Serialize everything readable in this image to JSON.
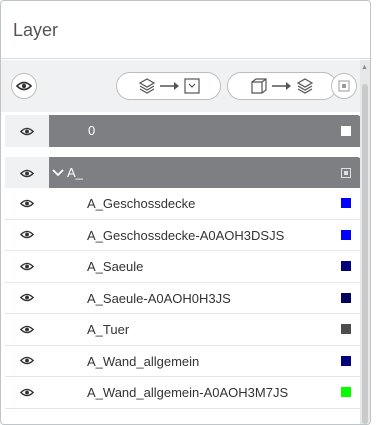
{
  "panel": {
    "title": "Layer"
  },
  "toolbar": {
    "visibility_icon": "eye-icon",
    "convert_layers_icon": "layers-to-dropdown-icon",
    "convert_box_icon": "box-to-layers-icon",
    "extra_icon": "square-dot-icon"
  },
  "groups": [
    {
      "name": "0",
      "color": "#ffffff"
    },
    {
      "name": "A_",
      "expanded": true,
      "color": "#e0e0e0"
    }
  ],
  "layers": [
    {
      "name": "A_Geschossdecke",
      "color": "#0000ff"
    },
    {
      "name": "A_Geschossdecke-A0AOH3DSJS",
      "color": "#0000ff"
    },
    {
      "name": "A_Saeule",
      "color": "#00007f"
    },
    {
      "name": "A_Saeule-A0AOH0H3JS",
      "color": "#00005f"
    },
    {
      "name": "A_Tuer",
      "color": "#4d4d4d"
    },
    {
      "name": "A_Wand_allgemein",
      "color": "#00007f"
    },
    {
      "name": "A_Wand_allgemein-A0AOH3M7JS",
      "color": "#00ff00"
    }
  ]
}
